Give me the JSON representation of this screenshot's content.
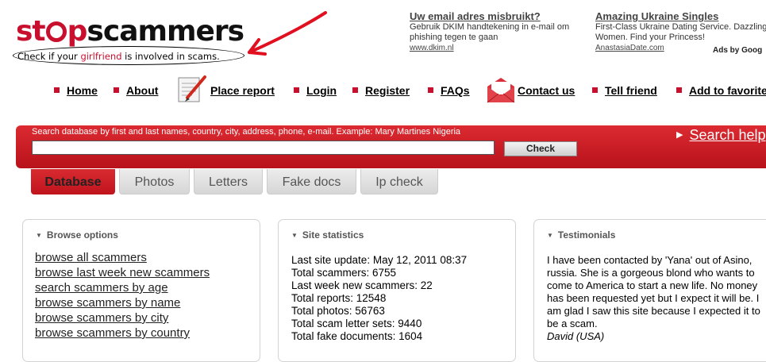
{
  "logo": {
    "part1": "st",
    "part2": "p",
    "part3": "scammers",
    "tagline_pre": "Check if your ",
    "tagline_highlight": "girlfriend",
    "tagline_post": " is involved in scams."
  },
  "ads": [
    {
      "title": "Uw email adres misbruikt?",
      "text": "Gebruik DKIM handtekening in e-mail om phishing tegen te gaan",
      "url": "www.dkim.nl"
    },
    {
      "title": "Amazing Ukraine Singles",
      "text": "First-Class Ukraine Dating Service. Dazzling Women. Find your Princess!",
      "url": "AnastasiaDate.com"
    }
  ],
  "ads_by": "Ads by Goog",
  "nav": [
    {
      "label": "Home"
    },
    {
      "label": "About"
    },
    {
      "label": "Place report",
      "icon": "report-pencil-icon"
    },
    {
      "label": "Login"
    },
    {
      "label": "Register"
    },
    {
      "label": "FAQs"
    },
    {
      "label": "Contact us",
      "icon": "envelope-icon"
    },
    {
      "label": "Tell friend"
    },
    {
      "label": "Add to favorite"
    }
  ],
  "search": {
    "hint": "Search database by first and last names, country, city, address, phone, e-mail. Example: Mary Martines Nigeria",
    "value": "",
    "check_label": "Check",
    "help_label": "Search help"
  },
  "tabs": [
    {
      "label": "Database",
      "active": true
    },
    {
      "label": "Photos",
      "active": false
    },
    {
      "label": "Letters",
      "active": false
    },
    {
      "label": "Fake docs",
      "active": false
    },
    {
      "label": "Ip check",
      "active": false
    }
  ],
  "browse": {
    "title": "Browse options",
    "links": [
      "browse all scammers",
      "browse last week new scammers",
      "search scammers by age",
      "browse scammers by name",
      "browse scammers by city",
      "browse scammers by country"
    ]
  },
  "stats": {
    "title": "Site statistics",
    "lines": [
      "Last site update: May 12, 2011 08:37",
      "Total scammers: 6755",
      "Last week new scammers: 22",
      "Total reports: 12548",
      "Total photos: 56763",
      "Total scam letter sets: 9440",
      "Total fake documents: 1604"
    ]
  },
  "testimonials": {
    "title": "Testimonials",
    "text": "I have been contacted by 'Yana' out of Asino, russia. She is a gorgeous blond who wants to come to America to start a new life. No money has been requested yet but I expect it will be. I am glad I saw this site because I expected it to be a scam.",
    "author": "David (USA)"
  },
  "colors": {
    "brand_red": "#c8102e"
  }
}
